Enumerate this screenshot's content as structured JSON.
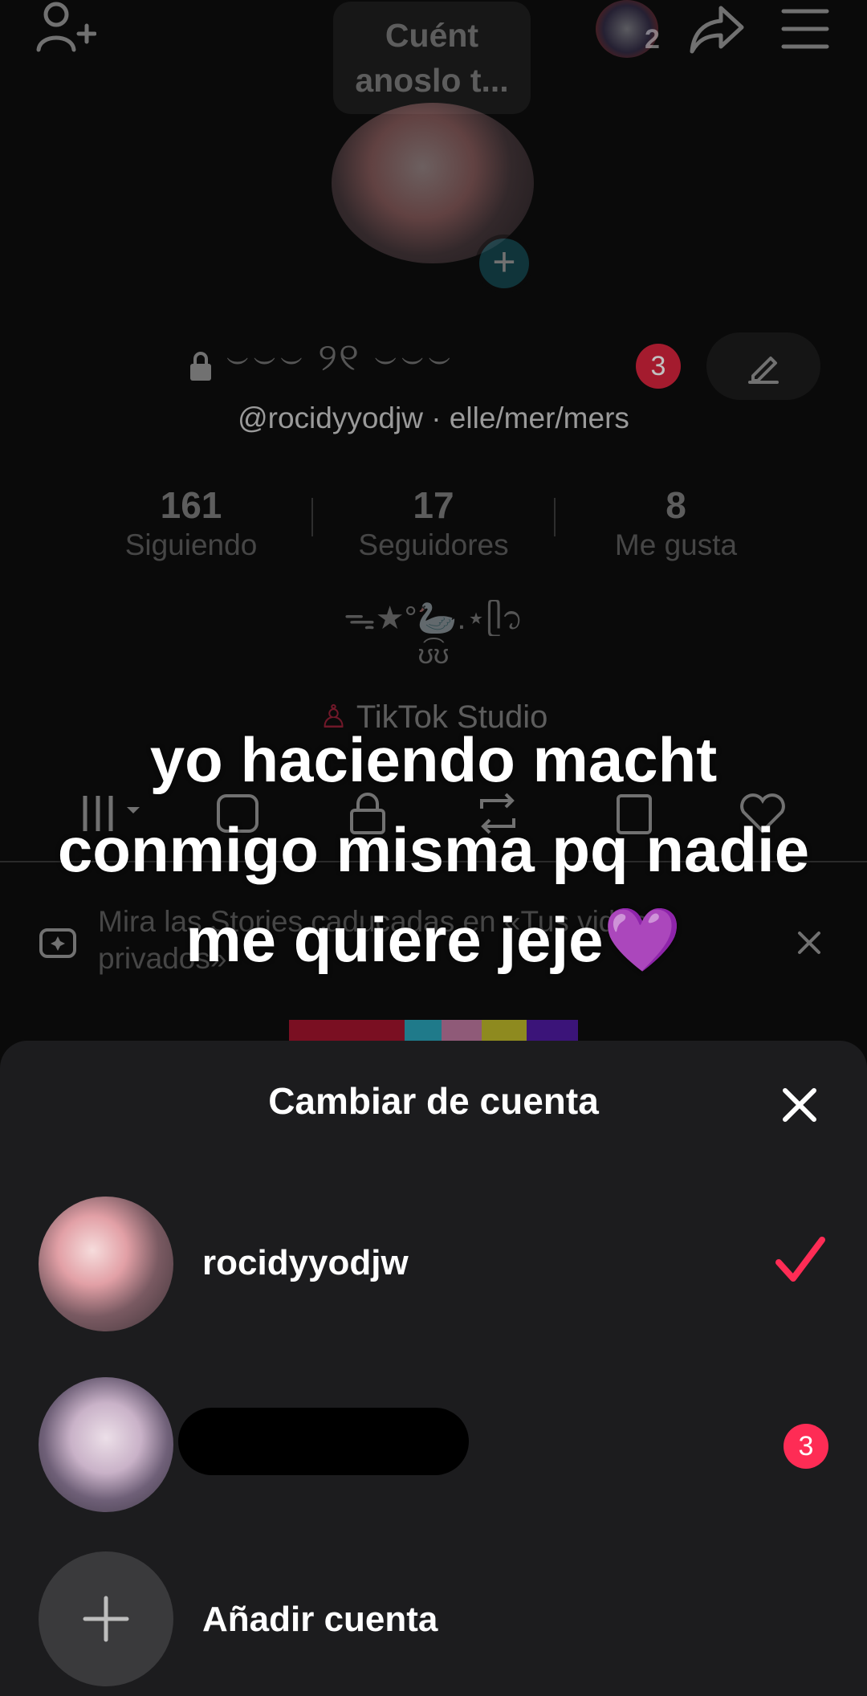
{
  "header": {
    "bubble_text": "Cuént anoslo t...",
    "accounts_badge": "2"
  },
  "profile": {
    "display_name": "⌣⌣⌣ ୨୧ ⌣⌣⌣",
    "notification_count": "3",
    "handle_line": "@rocidyyodjw · elle/mer/mers",
    "stats": [
      {
        "value": "161",
        "label": "Siguiendo"
      },
      {
        "value": "17",
        "label": "Seguidores"
      },
      {
        "value": "8",
        "label": "Me gusta"
      }
    ],
    "bio_line1": "ᯓ★°🦢.⋆ᥫ᭡",
    "bio_line2": "ʊ͡ʊ",
    "studio_label": "TikTok Studio",
    "stories_banner": "Mira las Stories caducadas en «Tus videos privados»"
  },
  "overlay": {
    "caption_line1": "yo haciendo macht",
    "caption_line2": "conmigo misma pq nadie",
    "caption_line3": "me quiere jeje💜"
  },
  "sheet": {
    "title": "Cambiar de cuenta",
    "accounts": [
      {
        "name": "rocidyyodjw",
        "selected": true
      },
      {
        "name": "",
        "badge": "3"
      }
    ],
    "add_label": "Añadir cuenta"
  },
  "colors": {
    "accent_red": "#fe2c55",
    "badge_red": "#d8213b",
    "sheet_bg": "#1c1c1e",
    "plus_teal": "#1a6f7d"
  }
}
